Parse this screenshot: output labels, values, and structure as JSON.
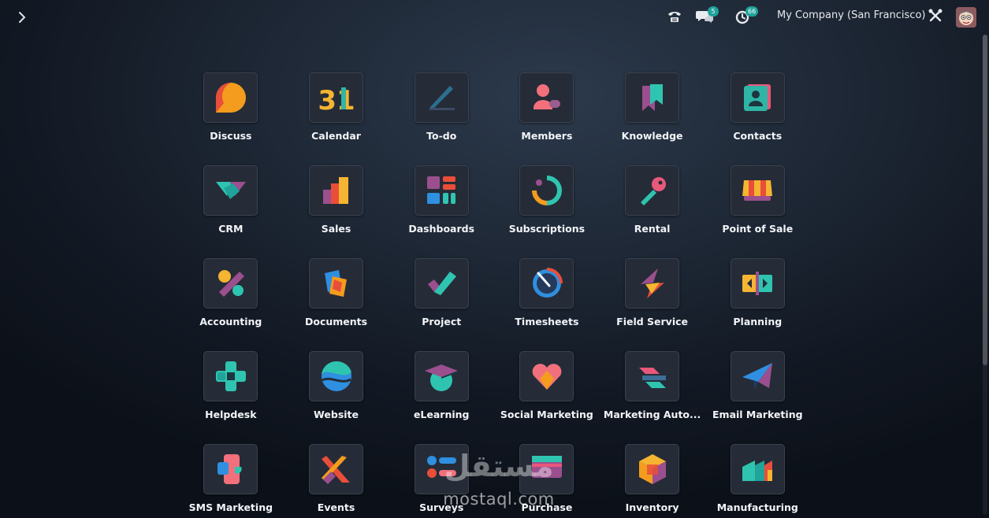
{
  "topbar": {
    "company": "My Company (San Francisco)",
    "messages_count": "5",
    "activities_count": "66",
    "icons": [
      "chevron-right-icon",
      "phone-icon",
      "chat-icon",
      "clock-icon",
      "tools-icon",
      "avatar"
    ]
  },
  "apps": [
    {
      "label": "Discuss",
      "icon": "discuss-icon"
    },
    {
      "label": "Calendar",
      "icon": "calendar-icon",
      "glyph": "31"
    },
    {
      "label": "To-do",
      "icon": "todo-icon"
    },
    {
      "label": "Members",
      "icon": "members-icon"
    },
    {
      "label": "Knowledge",
      "icon": "knowledge-icon"
    },
    {
      "label": "Contacts",
      "icon": "contacts-icon"
    },
    {
      "label": "CRM",
      "icon": "crm-icon"
    },
    {
      "label": "Sales",
      "icon": "sales-icon"
    },
    {
      "label": "Dashboards",
      "icon": "dashboards-icon"
    },
    {
      "label": "Subscriptions",
      "icon": "subscriptions-icon"
    },
    {
      "label": "Rental",
      "icon": "rental-icon"
    },
    {
      "label": "Point of Sale",
      "icon": "point-of-sale-icon"
    },
    {
      "label": "Accounting",
      "icon": "accounting-icon"
    },
    {
      "label": "Documents",
      "icon": "documents-icon"
    },
    {
      "label": "Project",
      "icon": "project-icon"
    },
    {
      "label": "Timesheets",
      "icon": "timesheets-icon"
    },
    {
      "label": "Field Service",
      "icon": "field-service-icon"
    },
    {
      "label": "Planning",
      "icon": "planning-icon"
    },
    {
      "label": "Helpdesk",
      "icon": "helpdesk-icon"
    },
    {
      "label": "Website",
      "icon": "website-icon"
    },
    {
      "label": "eLearning",
      "icon": "elearning-icon"
    },
    {
      "label": "Social Marketing",
      "icon": "social-marketing-icon"
    },
    {
      "label": "Marketing Auto...",
      "icon": "marketing-automation-icon"
    },
    {
      "label": "Email Marketing",
      "icon": "email-marketing-icon"
    },
    {
      "label": "SMS Marketing",
      "icon": "sms-marketing-icon"
    },
    {
      "label": "Events",
      "icon": "events-icon"
    },
    {
      "label": "Surveys",
      "icon": "surveys-icon"
    },
    {
      "label": "Purchase",
      "icon": "purchase-icon"
    },
    {
      "label": "Inventory",
      "icon": "inventory-icon"
    },
    {
      "label": "Manufacturing",
      "icon": "manufacturing-icon"
    }
  ],
  "watermark": {
    "text": "mostaql.com",
    "arabic": "مستقل"
  },
  "colors": {
    "badge": "#1fa39a",
    "background": "#161d28",
    "tile": "#252c37"
  }
}
